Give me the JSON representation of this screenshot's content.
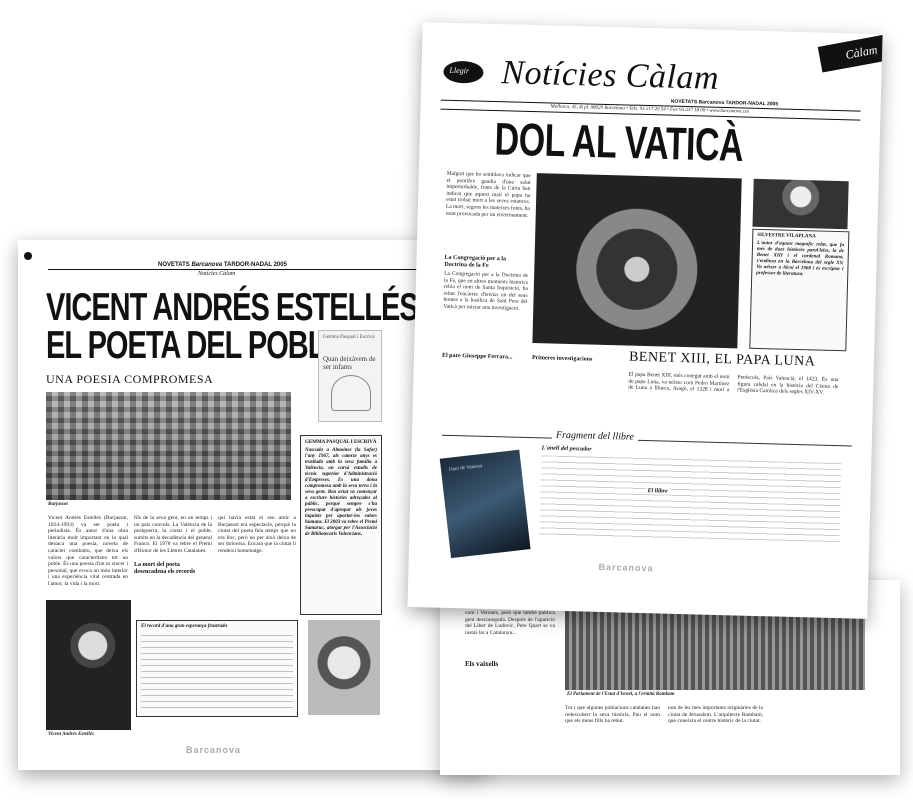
{
  "back_page": {
    "header_left": "NOVETATS",
    "header_brand": "Barcanova",
    "header_right": "TARDOR-NADAL 2005",
    "kicker": "Notícies Càlam",
    "title_line1": "VICENT ANDRÉS ESTELLÉS,",
    "title_line2": "EL POETA DEL POBLE",
    "subtitle": "UNA POESIA COMPROMESA",
    "book_cover_author": "Gemma Pasqual i Escrivà",
    "book_cover_title": "Quan deixàvem de ser infants",
    "photo_caption_city": "Burjassot",
    "photo_caption_man": "Vicent Andrés Estellés",
    "section_head_1": "La mort del poeta desencadena els records",
    "section_head_2": "El record d'una gran esperança frustrada",
    "sidebar_name": "GEMMA PASQUAL I ESCRIVÀ",
    "sidebar_text": "Nascuda a Almoines (la Safor) l'any 1967, als catorze anys es traslladà amb la seva família a València, on cursà estudis de tècnic superior d'Administració d'Empreses. Es una dona compromesa amb la seva terra i la seva gent. Ben aviat va començar a escriure històries adreçades al públic, perquè sempre s'ha preocupat d'apropar als joves inquiets per aportar-los valors humans. El 2003 va rebre el Premi Samaruc, atorgat per l'Associació de Bibliotecaris Valencians.",
    "body_col1": "Vicent Andrés Estellés (Burjassot, 1924-1993) va ser poeta i periodista. És autor d'una obra literària molt important en la qual destaca una poesia, novela de caràcter combatiu, que deixa els valors que caracteritzen tot un poble. És una poesia d'un to sincer i personal, que evoca un món interior i una experiència vital centrada en l'amor, la vida i la mort.",
    "body_col2": "fils de la seva gent, en un temps i un país convuls. La València de la postguerra, la ciutat i el poble, sumits en la decadència del general Franco. El 1978 va rebre el Premi d'Honor de les Lletres Catalanes.",
    "body_col3": "qui havia estat el seu amic a Burjassot era espectacle, perquè la ciutat del poeta feia temps que no era lloc, però no per això deixa de ser dolorosa. Encara que la ciutat li rendeixi homenatge.",
    "footer_brand": "Barcanova"
  },
  "front_page": {
    "logo_text": "Llegir",
    "masthead": "Notícies Càlam",
    "corner_tag": "Càlam",
    "issue_line": "NOVETATS Barcanova TARDOR-NADAL 2005",
    "address_line": "Mallorca, 45, 4t pl. 08029 Barcelona • Tels. 93 217 20 54 • Fax 93 237 18 09 • www.barcanova.cat",
    "headline": "DOL AL VATICÀ",
    "lead_text": "Malgrat que ho semblava indicar que el pontífex gaudia d'una salut imperturbable, fonts de la Cúria han indicat que aquest matí el papa ha estat trobat mort a les seves estances. La mort, segons les mateixes fonts, ha estat provocada per un enverinament.",
    "section_head_1": "La Congregació per a la Doctrina de la Fe",
    "section_text_1": "La Congregació per a la Doctrina de la Fe, que en altres moments històrics rebia el nom de Santa Inquisició, ha rebut l'encàrrec d'enviar un del seus homes a la basílica de Sant Pere del Vaticà per iniciar una investigació.",
    "section_head_2": "El pare Giuseppe Ferrara...",
    "section_head_3": "Primeres investigacions",
    "sidebar_author": "SILVESTRE VILAPLANA",
    "sidebar_bio": "L'autor d'aquest magnífic relat, que fa més de dues històries paral·leles, la de Benet XIII i el cardenal Romano, s'endinsa en la Barcelona del segle XV. Va néixer a Alcoi el 1968 i és escriptor i professor de literatura.",
    "second_headline": "BENET XIII, EL PAPA LUNA",
    "second_text": "El papa Benet XIII, més conegut amb el nom de papa Luna, va néixer com Pedro Martínez de Luna a Illueca, Aragó, el 1328 i morí a Peníscola, País Valencià, el 1423. És una figura cabdal en la història del Cisma de l'Església Catòlica dels segles XIV-XV.",
    "fragment_title": "Fragment del llibre",
    "fragment_subhead_1": "L'anell del pescador",
    "fragment_subhead_2": "El llibre",
    "book_caption": "Diari de Vanessa",
    "footer_brand": "Barcanova"
  },
  "bottom_spread": {
    "col_text_1": "com i Veronès, però que també publica gent desconeguda. Després de l'aparició del Liber de Ludovic, Pere Quart se va instal·lar a Catalunya...",
    "section_head": "Els vaixells",
    "photo_caption": "El Parlament de l'Estat d'Israel, a l'ermità Rambam",
    "col_text_2": "Tot i que algunes poblacions catalanes han redescobert la seva història, Pau el nom que els meus fills ha rebut.",
    "col_text_3": "non de les més importants originàries de la ciutat de Jerusalem. L'arquitecte Rambam, que coneixia el centre històric de la ciutat."
  }
}
